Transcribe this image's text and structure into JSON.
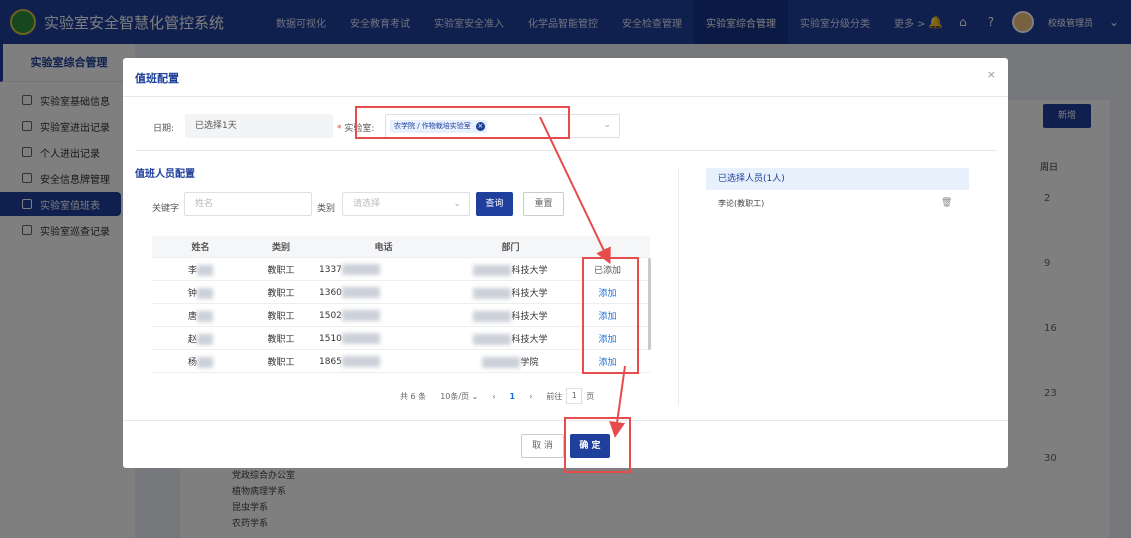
{
  "app": {
    "title": "实验室安全智慧化管控系统"
  },
  "nav": {
    "items": [
      "数据可视化",
      "安全教育考试",
      "实验室安全准入",
      "化学品智能管控",
      "安全检查管理",
      "实验室综合管理",
      "实验室分级分类",
      "更多 >"
    ],
    "active_index": 5
  },
  "user": {
    "name": "校级管理员"
  },
  "sidebar": {
    "title": "实验室综合管理",
    "items": [
      "实验室基础信息",
      "实验室进出记录",
      "个人进出记录",
      "安全信息牌管理",
      "实验室值班表",
      "实验室巡查记录"
    ],
    "active_index": 4
  },
  "background": {
    "new_button": "新增",
    "col_header": "周日",
    "day_numbers": [
      "2",
      "9",
      "16",
      "23",
      "30"
    ],
    "list_items": [
      "党政综合办公室",
      "植物病理学系",
      "昆虫学系",
      "农药学系"
    ]
  },
  "modal": {
    "title": "值班配置",
    "close": "×",
    "date_label": "日期:",
    "date_value": "已选择1天",
    "lab_label": "实验室:",
    "lab_tag": "农学院 / 作物栽培实验室",
    "section_title": "值班人员配置",
    "keyword_label": "关键字",
    "keyword_placeholder": "姓名",
    "category_label": "类别",
    "category_placeholder": "请选择",
    "query_button": "查询",
    "reset_button": "重置",
    "table": {
      "headers": [
        "姓名",
        "类别",
        "电话",
        "部门",
        ""
      ],
      "rows": [
        {
          "name": "李",
          "category": "教职工",
          "phone": "1337",
          "dept": "科技大学",
          "action": "已添加"
        },
        {
          "name": "钟",
          "category": "教职工",
          "phone": "1360",
          "dept": "科技大学",
          "action": "添加"
        },
        {
          "name": "唐",
          "category": "教职工",
          "phone": "1502",
          "dept": "科技大学",
          "action": "添加"
        },
        {
          "name": "赵",
          "category": "教职工",
          "phone": "1510",
          "dept": "科技大学",
          "action": "添加"
        },
        {
          "name": "杨",
          "category": "教职工",
          "phone": "1865",
          "dept": "学院",
          "action": "添加"
        }
      ]
    },
    "pager": {
      "total": "共 6 条",
      "page_size": "10条/页",
      "current": "1",
      "goto_label": "前往",
      "goto_value": "1",
      "page_unit": "页"
    },
    "selected": {
      "header": "已选择人员(1人)",
      "people": [
        "李论(教职工)"
      ]
    },
    "cancel_button": "取 消",
    "confirm_button": "确 定"
  },
  "colors": {
    "primary": "#1e3f9c",
    "annotation": "#e74c4c",
    "link": "#1e6fd9"
  }
}
